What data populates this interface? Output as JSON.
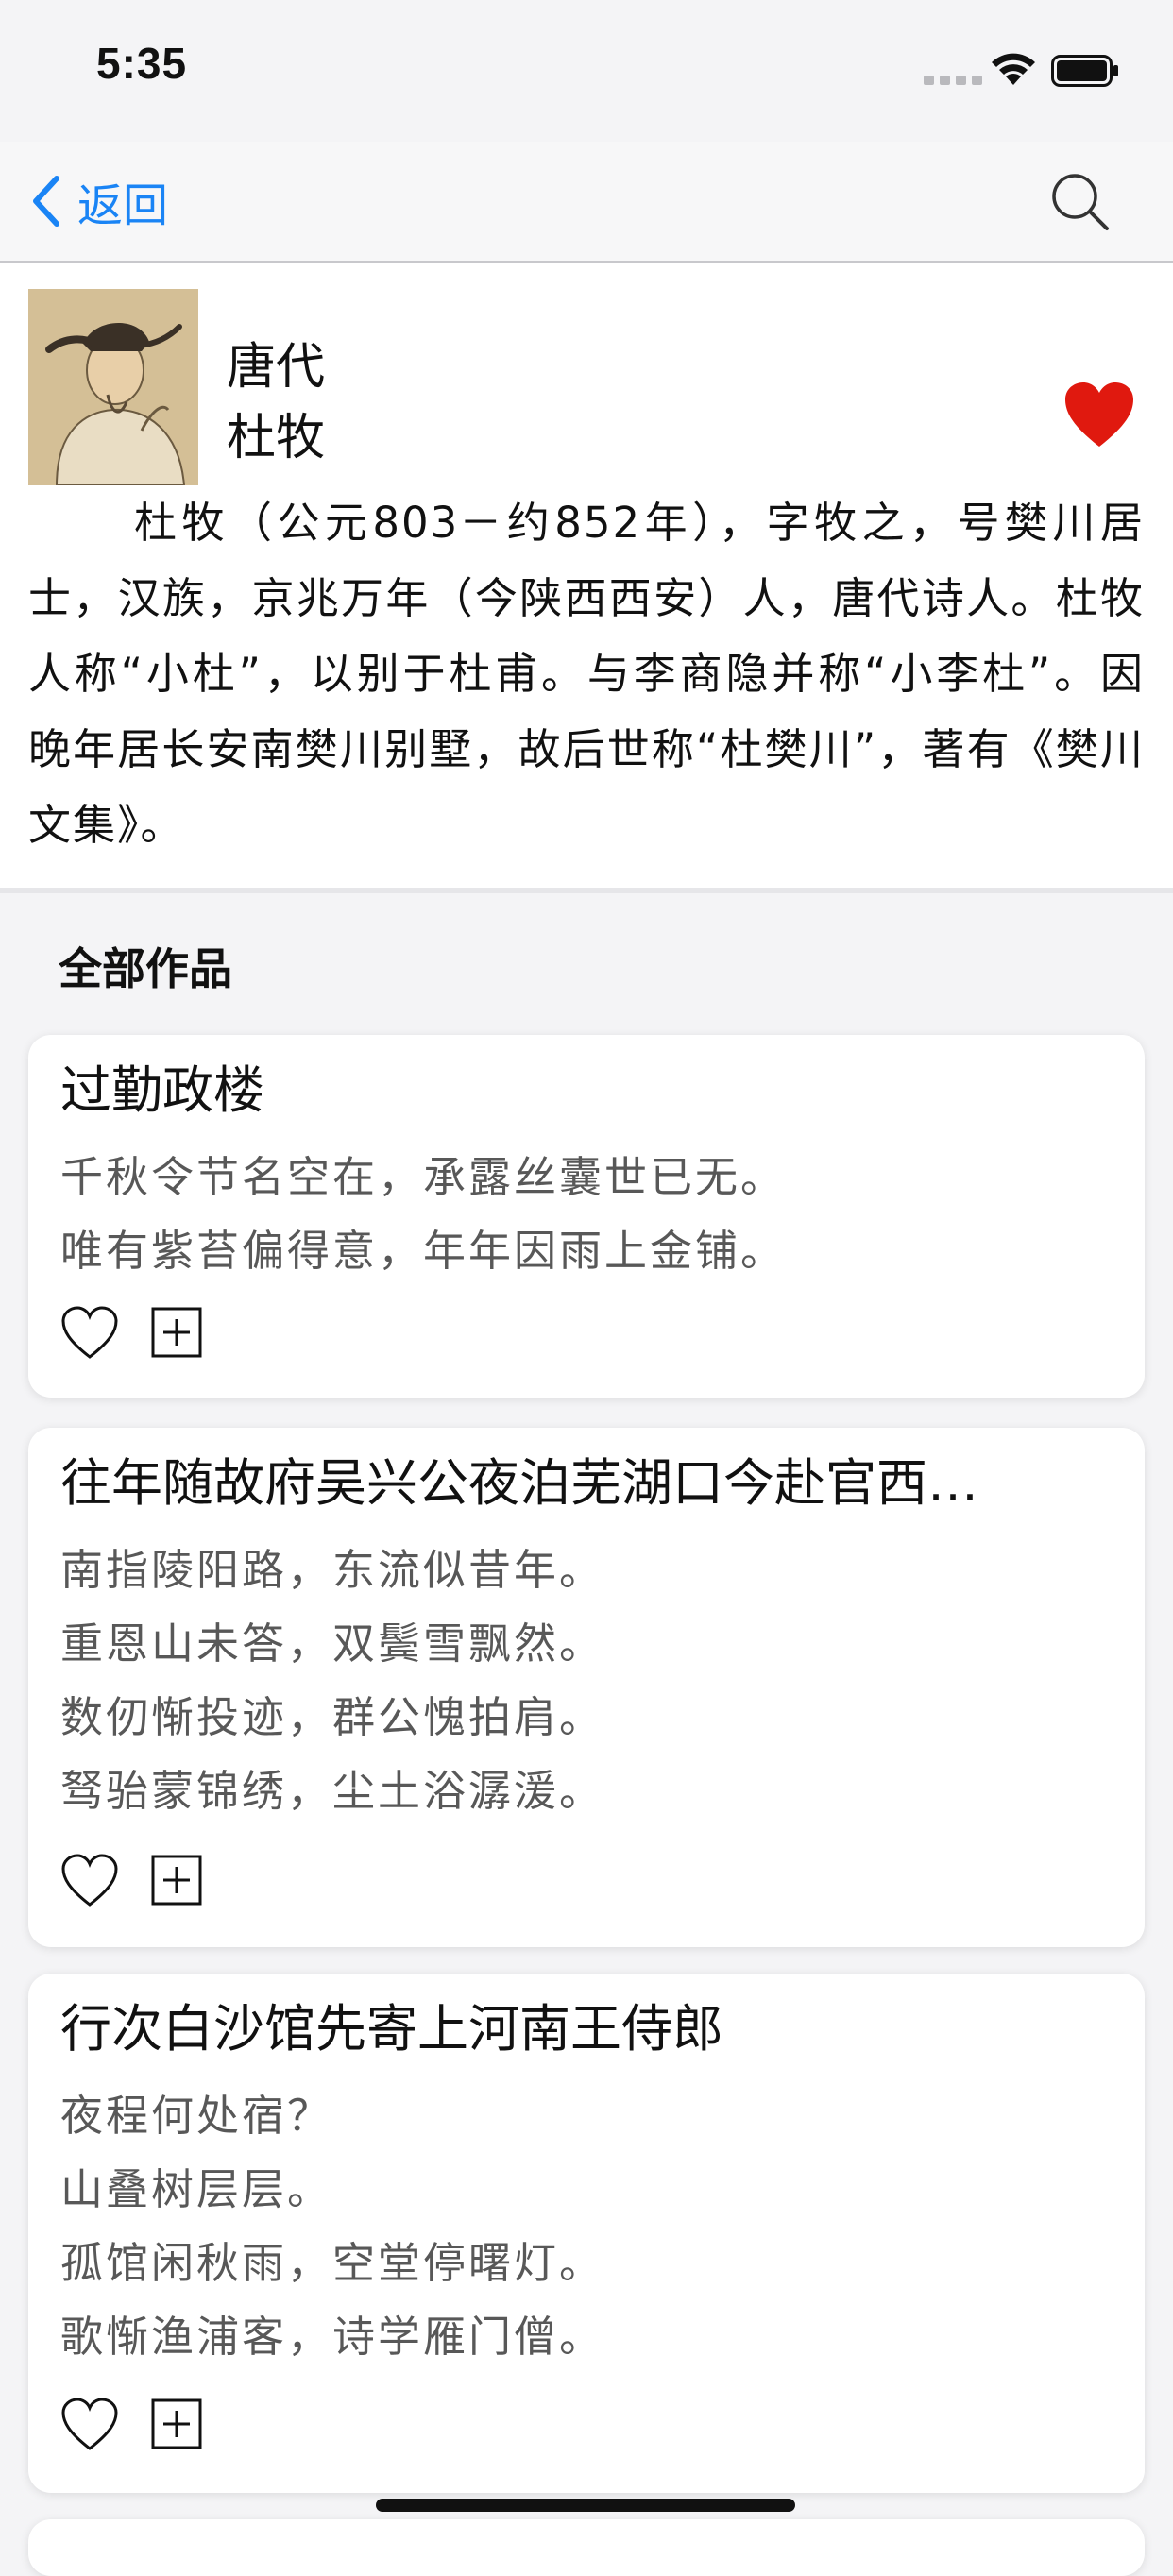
{
  "status_bar": {
    "time": "5:35"
  },
  "nav": {
    "back_label": "返回",
    "back_icon": "chevron-left-icon",
    "search_icon": "search-icon",
    "accent": "#1a84f5"
  },
  "author": {
    "dynasty": "唐代",
    "name": "杜牧",
    "favorited": true,
    "heart_color": "#e0190f",
    "bio": "杜牧（公元803－约852年），字牧之，号樊川居士，汉族，京兆万年（今陕西西安）人，唐代诗人。杜牧人称“小杜”，以别于杜甫。与李商隐并称“小李杜”。因晚年居长安南樊川别墅，故后世称“杜樊川”，著有《樊川文集》。"
  },
  "section": {
    "title": "全部作品"
  },
  "poems": [
    {
      "title": "过勤政楼",
      "lines": [
        "千秋令节名空在，承露丝囊世已无。",
        "唯有紫苔偏得意，年年因雨上金铺。"
      ]
    },
    {
      "title": "往年随故府吴兴公夜泊芜湖口今赴官西…",
      "lines": [
        "南指陵阳路，东流似昔年。",
        "重恩山未答，双鬓雪飘然。",
        "数仞惭投迹，群公愧拍肩。",
        "驽骀蒙锦绣，尘土浴潺湲。"
      ]
    },
    {
      "title": "行次白沙馆先寄上河南王侍郎",
      "lines": [
        "夜程何处宿？",
        "山叠树层层。",
        "孤馆闲秋雨，空堂停曙灯。",
        "歌惭渔浦客，诗学雁门僧。"
      ]
    }
  ]
}
